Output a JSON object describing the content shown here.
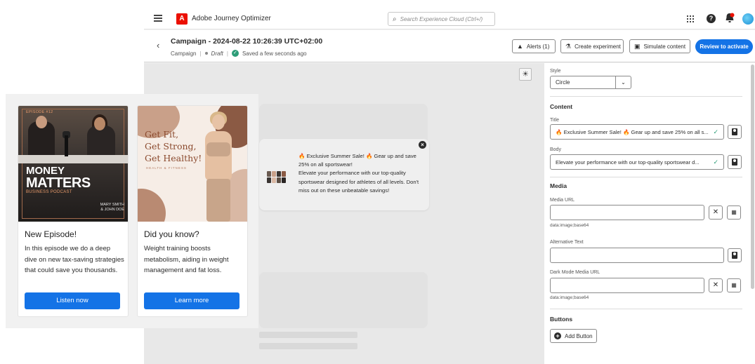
{
  "app": {
    "name": "Adobe Journey Optimizer",
    "search_placeholder": "Search Experience Cloud (Ctrl+/)"
  },
  "header": {
    "title": "Campaign - 2024-08-22 10:26:39 UTC+02:00",
    "type": "Campaign",
    "status": "Draft",
    "saved": "Saved a few seconds ago",
    "alerts_label": "Alerts (1)",
    "experiment_label": "Create experiment",
    "simulate_label": "Simulate content",
    "review_label": "Review to activate"
  },
  "preview": {
    "title": "🔥 Exclusive Summer Sale! 🔥  Gear up and save 25% on all sportswear!",
    "body": "Elevate your performance with our top-quality sportswear designed for athletes of all levels. Don't miss out on these unbeatable savings!"
  },
  "panel": {
    "style_label": "Style",
    "style_value": "Circle",
    "content_heading": "Content",
    "title_label": "Title",
    "title_value": "🔥 Exclusive Summer Sale! 🔥  Gear up and save 25% on all s...",
    "body_label": "Body",
    "body_value": "Elevate your performance with our top-quality sportswear d...",
    "media_heading": "Media",
    "media_url_label": "Media URL",
    "media_url_value": "",
    "media_hint": "data:image;base64",
    "alt_text_label": "Alternative Text",
    "alt_text_value": "",
    "dark_media_label": "Dark Mode Media URL",
    "dark_media_value": "",
    "dark_media_hint": "data:image;base64",
    "buttons_heading": "Buttons",
    "add_button_label": "Add Button"
  },
  "cards": [
    {
      "episode_tag": "EPISODE #12",
      "image_line1": "MONEY",
      "image_line2": "MATTERS",
      "image_sub": "BUSINESS PODCAST",
      "image_names_1": "MARY SMITH",
      "image_names_2": "& JOHN DOE",
      "title": "New Episode!",
      "body": "In this episode we do a deep dive on new tax-saving strategies that could save you thousands.",
      "button": "Listen now"
    },
    {
      "image_line1": "Get Fit,",
      "image_line2": "Get Strong,",
      "image_line3": "Get Healthy!",
      "image_sub": "HEALTH & FITNESS",
      "title": "Did you know?",
      "body": "Weight training boosts metabolism, aiding in weight management and fat loss.",
      "button": "Learn more"
    }
  ],
  "colors": {
    "accent": "#1473e6",
    "brand": "#eb1000",
    "success": "#2d9d78"
  }
}
